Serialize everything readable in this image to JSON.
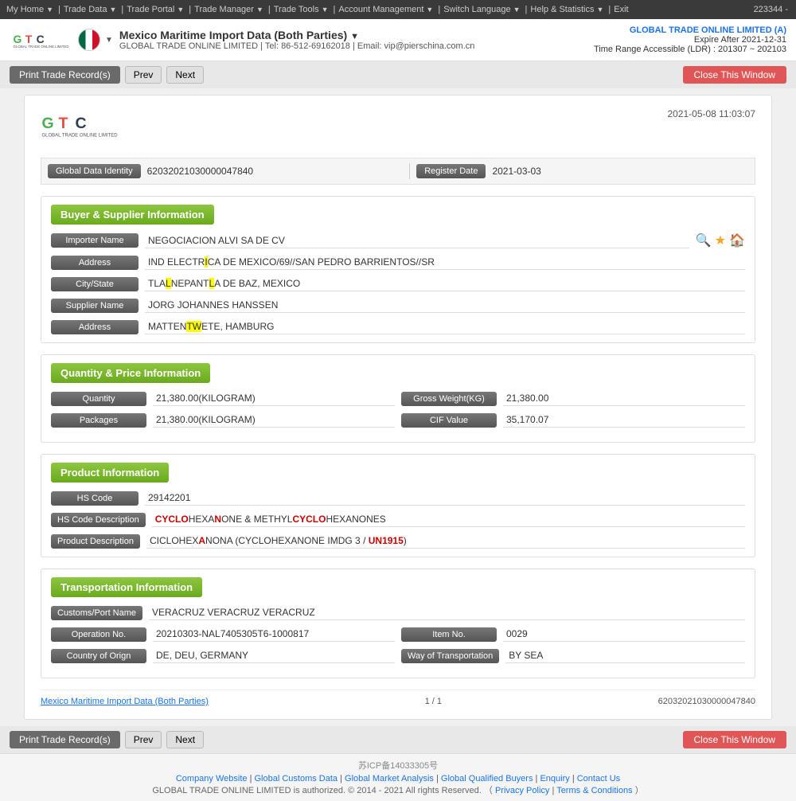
{
  "topnav": {
    "items": [
      {
        "label": "My Home",
        "arrow": true
      },
      {
        "label": "Trade Data",
        "arrow": true
      },
      {
        "label": "Trade Portal",
        "arrow": true
      },
      {
        "label": "Trade Manager",
        "arrow": true
      },
      {
        "label": "Trade Tools",
        "arrow": true
      },
      {
        "label": "Account Management",
        "arrow": true
      },
      {
        "label": "Switch Language",
        "arrow": true
      },
      {
        "label": "Help & Statistics",
        "arrow": true
      },
      {
        "label": "Exit",
        "arrow": false
      }
    ],
    "account_number": "223344 -"
  },
  "header": {
    "title": "Mexico Maritime Import Data (Both Parties)",
    "contact": "GLOBAL TRADE ONLINE LIMITED | Tel: 86-512-69162018 | Email: vip@pierschina.com.cn",
    "company_name": "GLOBAL TRADE ONLINE LIMITED (A)",
    "expire": "Expire After 2021-12-31",
    "time_range": "Time Range Accessible (LDR) : 201307 ~ 202103"
  },
  "toolbar_top": {
    "print_label": "Print Trade Record(s)",
    "prev_label": "Prev",
    "next_label": "Next",
    "close_label": "Close This Window"
  },
  "toolbar_bottom": {
    "print_label": "Print Trade Record(s)",
    "prev_label": "Prev",
    "next_label": "Next",
    "close_label": "Close This Window"
  },
  "record": {
    "datetime": "2021-05-08 11:03:07",
    "global_data_identity_label": "Global Data Identity",
    "global_data_identity_value": "62032021030000047840",
    "register_date_label": "Register Date",
    "register_date_value": "2021-03-03",
    "sections": {
      "buyer_supplier": {
        "title": "Buyer & Supplier Information",
        "importer_name_label": "Importer Name",
        "importer_name_value": "NEGOCIACION ALVI SA DE CV",
        "address_label": "Address",
        "address_value": "IND ELECTRICA DE MEXICO/69//SAN PEDRO BARRIENTOS//SR",
        "city_state_label": "City/State",
        "city_state_value": "TLALNEPANTLA DE BAZ, MEXICO",
        "supplier_name_label": "Supplier Name",
        "supplier_name_value": "JORG JOHANNES HANSSEN",
        "supplier_address_label": "Address",
        "supplier_address_value": "MATTENTWETE, HAMBURG"
      },
      "quantity_price": {
        "title": "Quantity & Price Information",
        "quantity_label": "Quantity",
        "quantity_value": "21,380.00(KILOGRAM)",
        "gross_weight_label": "Gross Weight(KG)",
        "gross_weight_value": "21,380.00",
        "packages_label": "Packages",
        "packages_value": "21,380.00(KILOGRAM)",
        "cif_value_label": "CIF Value",
        "cif_value": "35,170.07"
      },
      "product": {
        "title": "Product Information",
        "hs_code_label": "HS Code",
        "hs_code_value": "29142201",
        "hs_code_desc_label": "HS Code Description",
        "hs_code_desc_value": "CYCLOHEXANONE & METHYLCYCLOHEXANONES",
        "product_desc_label": "Product Description",
        "product_desc_value": "CICLOHEXANONA (CYCLOHEXANONE IMDG 3 / UN1915)"
      },
      "transportation": {
        "title": "Transportation Information",
        "customs_port_label": "Customs/Port Name",
        "customs_port_value": "VERACRUZ VERACRUZ VERACRUZ",
        "operation_no_label": "Operation No.",
        "operation_no_value": "20210303-NAL7405305T6-1000817",
        "item_no_label": "Item No.",
        "item_no_value": "0029",
        "country_origin_label": "Country of Orign",
        "country_origin_value": "DE, DEU, GERMANY",
        "way_transport_label": "Way of Transportation",
        "way_transport_value": "BY SEA"
      }
    },
    "footer": {
      "source_label": "Mexico Maritime Import Data (Both Parties)",
      "page_info": "1 / 1",
      "record_id": "62032021030000047840"
    }
  },
  "page_footer": {
    "icp": "苏ICP备14033305号",
    "links": [
      "Company Website",
      "Global Customs Data",
      "Global Market Analysis",
      "Global Qualified Buyers",
      "Enquiry",
      "Contact Us"
    ],
    "copyright": "GLOBAL TRADE ONLINE LIMITED is authorized. © 2014 - 2021 All rights Reserved.  （",
    "privacy_policy": "Privacy Policy",
    "separator": "|",
    "terms": "Terms & Conditions",
    "end": "）"
  }
}
